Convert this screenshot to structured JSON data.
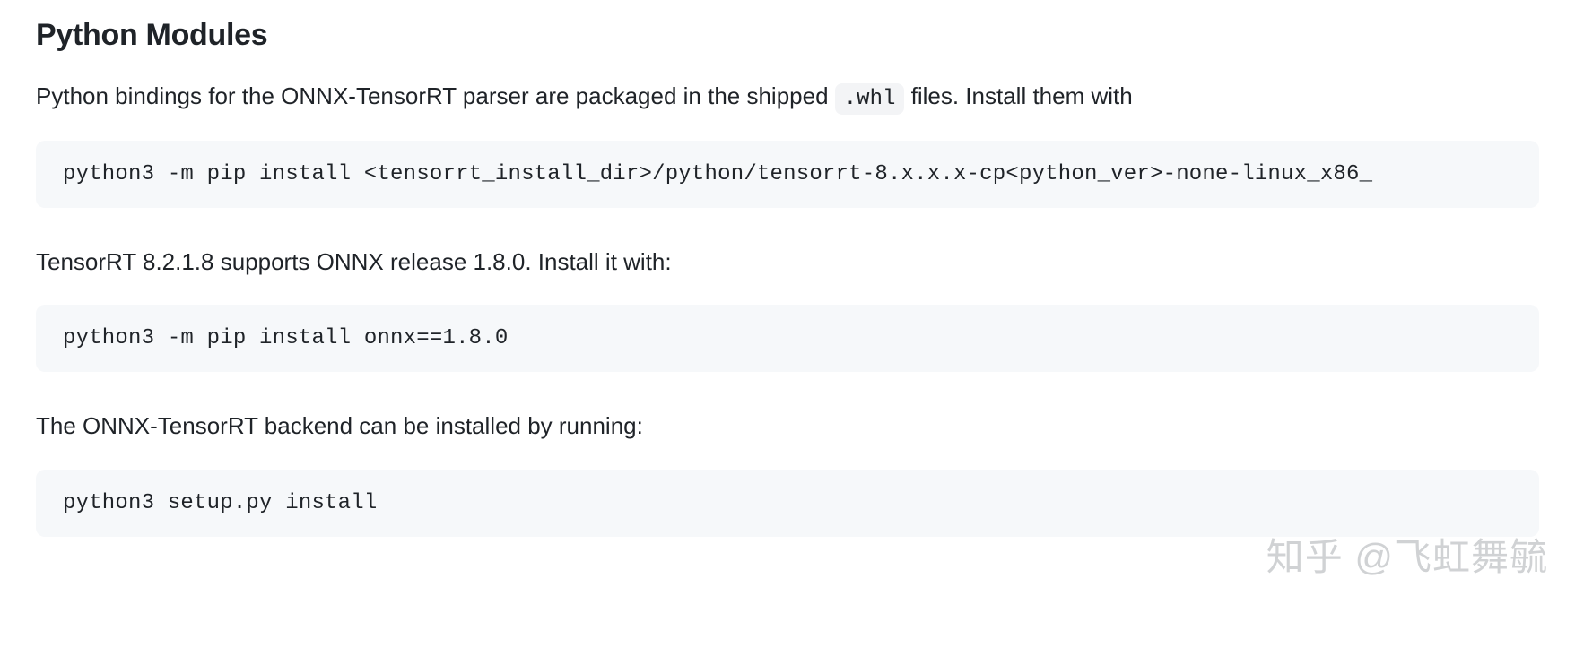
{
  "heading": "Python Modules",
  "paragraphs": {
    "p1_before": "Python bindings for the ONNX-TensorRT parser are packaged in the shipped ",
    "p1_code": ".whl",
    "p1_after": " files. Install them with",
    "p2": "TensorRT 8.2.1.8 supports ONNX release 1.8.0. Install it with:",
    "p3": "The ONNX-TensorRT backend can be installed by running:"
  },
  "code_blocks": {
    "c1": "python3 -m pip install <tensorrt_install_dir>/python/tensorrt-8.x.x.x-cp<python_ver>-none-linux_x86_",
    "c2": "python3 -m pip install onnx==1.8.0",
    "c3": "python3 setup.py install"
  },
  "watermark": "知乎 @飞虹舞毓"
}
